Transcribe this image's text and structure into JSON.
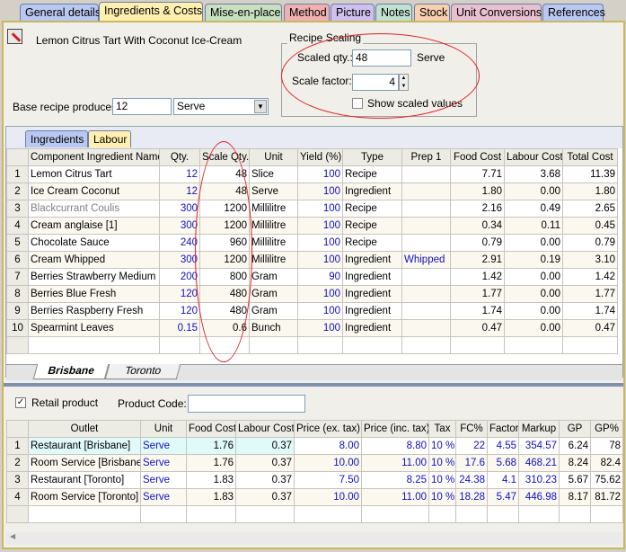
{
  "tabs": [
    {
      "label": "General details",
      "color": "#b8c8f0"
    },
    {
      "label": "Ingredients & Costs",
      "color": "#fff0b0"
    },
    {
      "label": "Mise-en-place",
      "color": "#c8e0c0"
    },
    {
      "label": "Method",
      "color": "#f0b0b0"
    },
    {
      "label": "Picture",
      "color": "#d0c0f0"
    },
    {
      "label": "Notes",
      "color": "#c0e0d0"
    },
    {
      "label": "Stock",
      "color": "#f8d0b0"
    },
    {
      "label": "Unit Conversions",
      "color": "#e8c0d0"
    },
    {
      "label": "References",
      "color": "#b8c8f0"
    }
  ],
  "recipe": {
    "title": "Lemon Citrus Tart With Coconut Ice-Cream",
    "base_label": "Base recipe produces:",
    "base_qty": "12",
    "base_unit": "Serve"
  },
  "scaling": {
    "legend": "Recipe Scaling",
    "scaled_qty_label": "Scaled qty.:",
    "scaled_qty": "48",
    "scaled_unit": "Serve",
    "factor_label": "Scale factor:",
    "factor": "4",
    "show_scaled_label": "Show scaled values",
    "show_scaled": false
  },
  "subtabs": [
    "Ingredients",
    "Labour"
  ],
  "ingredients": {
    "columns": [
      "",
      "Component Ingredient Name",
      "Qty.",
      "Scale Qty.",
      "Unit",
      "Yield (%)",
      "Type",
      "Prep 1",
      "Food Cost",
      "Labour Cost",
      "Total Cost"
    ],
    "rows": [
      [
        "1",
        "Lemon Citrus Tart",
        "12",
        "48",
        "Slice",
        "100",
        "Recipe",
        "",
        "7.71",
        "3.68",
        "11.39"
      ],
      [
        "2",
        "Ice Cream Coconut",
        "12",
        "48",
        "Serve",
        "100",
        "Ingredient",
        "",
        "1.80",
        "0.00",
        "1.80"
      ],
      [
        "3",
        "Blackcurrant Coulis",
        "300",
        "1200",
        "Millilitre",
        "100",
        "Recipe",
        "",
        "2.16",
        "0.49",
        "2.65"
      ],
      [
        "4",
        "Cream anglaise [1]",
        "300",
        "1200",
        "Millilitre",
        "100",
        "Recipe",
        "",
        "0.34",
        "0.11",
        "0.45"
      ],
      [
        "5",
        "Chocolate Sauce",
        "240",
        "960",
        "Millilitre",
        "100",
        "Recipe",
        "",
        "0.79",
        "0.00",
        "0.79"
      ],
      [
        "6",
        "Cream Whipped",
        "300",
        "1200",
        "Millilitre",
        "100",
        "Ingredient",
        "Whipped",
        "2.91",
        "0.19",
        "3.10"
      ],
      [
        "7",
        "Berries Strawberry Medium Fresh",
        "200",
        "800",
        "Gram",
        "90",
        "Ingredient",
        "",
        "1.42",
        "0.00",
        "1.42"
      ],
      [
        "8",
        "Berries Blue Fresh",
        "120",
        "480",
        "Gram",
        "100",
        "Ingredient",
        "",
        "1.77",
        "0.00",
        "1.77"
      ],
      [
        "9",
        "Berries Raspberry Fresh",
        "120",
        "480",
        "Gram",
        "100",
        "Ingredient",
        "",
        "1.74",
        "0.00",
        "1.74"
      ],
      [
        "10",
        "Spearmint Leaves",
        "0.15",
        "0.6",
        "Bunch",
        "100",
        "Ingredient",
        "",
        "0.47",
        "0.00",
        "0.47"
      ]
    ]
  },
  "outlet_tabs": [
    "Brisbane",
    "Toronto"
  ],
  "retail": {
    "label": "Retail product",
    "checked": true,
    "code_label": "Product Code:",
    "code": ""
  },
  "outlets": {
    "columns": [
      "",
      "Outlet",
      "Unit",
      "Food Cost",
      "Labour Cost",
      "Price (ex. tax)",
      "Price (inc. tax)",
      "Tax",
      "FC%",
      "Factor",
      "Markup",
      "GP",
      "GP%"
    ],
    "rows": [
      [
        "1",
        "Restaurant [Brisbane]",
        "Serve",
        "1.76",
        "0.37",
        "8.00",
        "8.80",
        "10 %",
        "22",
        "4.55",
        "354.57",
        "6.24",
        "78"
      ],
      [
        "2",
        "Room Service [Brisbane]",
        "Serve",
        "1.76",
        "0.37",
        "10.00",
        "11.00",
        "10 %",
        "17.6",
        "5.68",
        "468.21",
        "8.24",
        "82.4"
      ],
      [
        "3",
        "Restaurant [Toronto]",
        "Serve",
        "1.83",
        "0.37",
        "7.50",
        "8.25",
        "10 %",
        "24.38",
        "4.1",
        "310.23",
        "5.67",
        "75.62"
      ],
      [
        "4",
        "Room Service [Toronto]",
        "Serve",
        "1.83",
        "0.37",
        "10.00",
        "11.00",
        "10 %",
        "18.28",
        "5.47",
        "446.98",
        "8.17",
        "81.72"
      ]
    ]
  }
}
